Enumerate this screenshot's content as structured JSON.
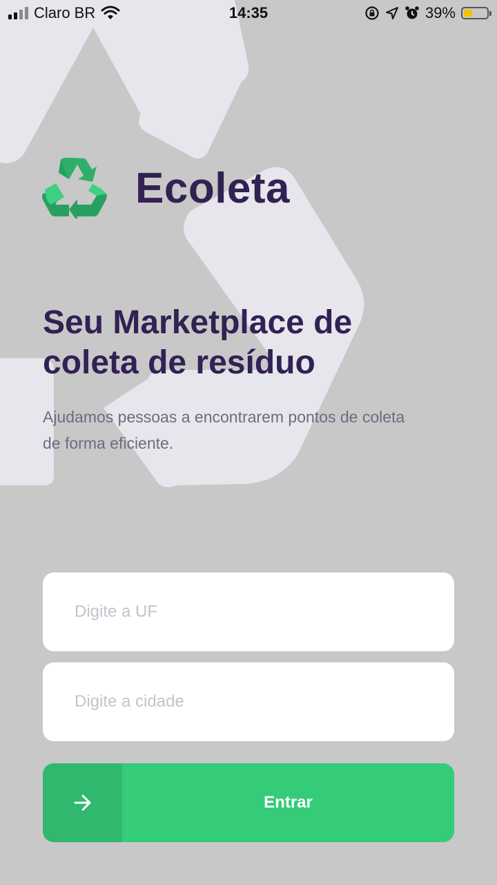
{
  "status_bar": {
    "carrier": "Claro BR",
    "time": "14:35",
    "battery_percent_label": "39%",
    "battery_level": 0.39,
    "icons": [
      "signal-icon",
      "wifi-icon",
      "orientation-lock-icon",
      "location-icon",
      "alarm-icon",
      "battery-icon"
    ]
  },
  "app": {
    "name": "Ecoleta",
    "logo_icon": "recycle-icon",
    "brand_color": "#34cb79",
    "title_color": "#322153"
  },
  "hero": {
    "title": "Seu Marketplace de coleta de resíduo",
    "description": "Ajudamos pessoas a encontrarem pontos de coleta de forma eficiente."
  },
  "form": {
    "uf_placeholder": "Digite a UF",
    "city_placeholder": "Digite a cidade",
    "submit_label": "Entrar",
    "submit_icon": "arrow-right-icon"
  }
}
